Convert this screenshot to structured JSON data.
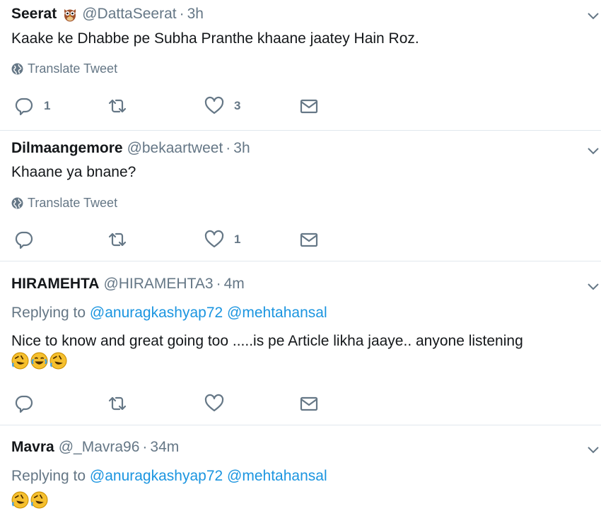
{
  "tweets": [
    {
      "name": "Seerat",
      "handle": "@DattaSeerat",
      "time": "3h",
      "text": "Kaake ke Dhabbe pe Subha Pranthe khaane jaatey Hain Roz.",
      "translate": "Translate Tweet",
      "reply_count": "1",
      "retweet_count": "",
      "like_count": "3"
    },
    {
      "name": "Dilmaangemore",
      "handle": "@bekaartweet",
      "time": "3h",
      "text": "Khaane ya bnane?",
      "translate": "Translate Tweet",
      "reply_count": "",
      "retweet_count": "",
      "like_count": "1"
    },
    {
      "name": "HIRAMEHTA",
      "handle": "@HIRAMEHTA3",
      "time": "4m",
      "replying_prefix": "Replying to",
      "mention1": "@anuragkashyap72",
      "mention2": "@mehtahansal",
      "text": "Nice to know and great going too .....is pe Article likha jaaye.. anyone listening",
      "reply_count": "",
      "retweet_count": "",
      "like_count": ""
    },
    {
      "name": "Mavra",
      "handle": "@_Mavra96",
      "time": "34m",
      "replying_prefix": "Replying to",
      "mention1": "@anuragkashyap72",
      "mention2": "@mehtahansal"
    }
  ],
  "separator": "·",
  "icons": {
    "badge": "owl-emoji-icon",
    "menu": "chevron-down-icon",
    "translate": "globe-icon",
    "reply": "reply-icon",
    "retweet": "retweet-icon",
    "like": "heart-icon",
    "dm": "envelope-icon",
    "emoji_rofl": "rolling-laughing-emoji-icon",
    "emoji_joy": "tears-of-joy-emoji-icon"
  },
  "colors": {
    "text": "#14171a",
    "secondary": "#657786",
    "mention": "#1b95e0",
    "divider": "#e1e8ed"
  }
}
